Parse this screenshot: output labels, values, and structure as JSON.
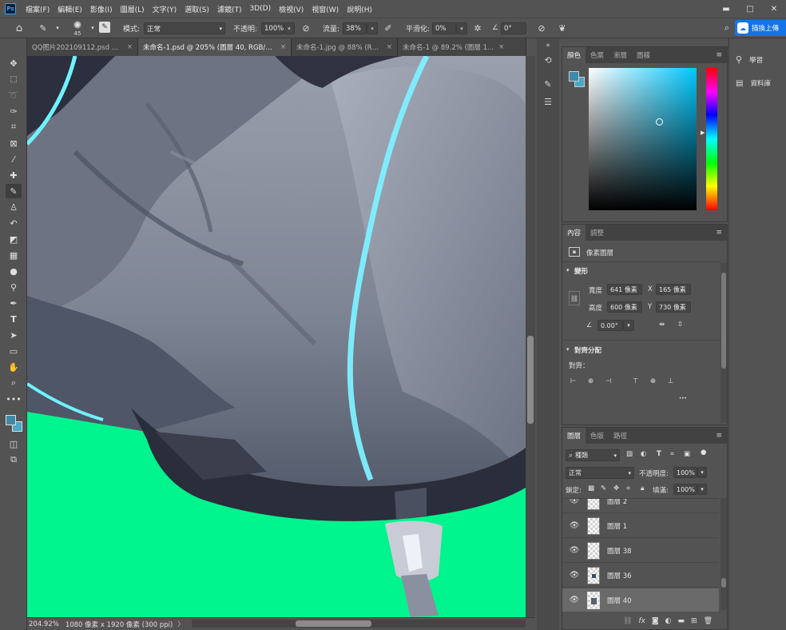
{
  "app": {
    "logo": "Ps"
  },
  "menu": [
    "檔案(F)",
    "編輯(E)",
    "影像(I)",
    "圖層(L)",
    "文字(Y)",
    "選取(S)",
    "濾鏡(T)",
    "3D(D)",
    "檢視(V)",
    "視窗(W)",
    "說明(H)"
  ],
  "window_controls": {
    "minimize": "▬",
    "maximize": "□",
    "close": "✕"
  },
  "options": {
    "brush_size": "45",
    "mode_label": "模式:",
    "mode_value": "正常",
    "opacity_label": "不透明:",
    "opacity_value": "100%",
    "flow_label": "流量:",
    "flow_value": "38%",
    "smoothing_label": "平滑化:",
    "smoothing_value": "0%",
    "angle_value": "0°",
    "share_button": "描換上傳"
  },
  "tabs": [
    {
      "label": "QQ图片202109112.psd @...",
      "active": false
    },
    {
      "label": "未命名-1.psd @ 205% (圖層 40, RGB/8) *",
      "active": true
    },
    {
      "label": "未命名-1.jpg @ 88% (RG...",
      "active": false
    },
    {
      "label": "未命名-1 @ 89.2% (圖層 1...",
      "active": false
    }
  ],
  "status": {
    "zoom": "204.92%",
    "doc_info": "1080 像素 x 1920 像素 (300 ppi)",
    "arrow": "〉"
  },
  "color_panel": {
    "tabs": [
      "顏色",
      "色票",
      "漸層",
      "圖樣"
    ],
    "foreground": "#3f8aa6",
    "background": "#4aa8c8",
    "hue": "#00c8ff"
  },
  "learn_panel": {
    "learn": "學習",
    "library": "資料庫"
  },
  "properties_panel": {
    "tabs": [
      "內容",
      "調整"
    ],
    "layer_type": "像素圖層",
    "transform_title": "變形",
    "width_label": "寬度",
    "width_value": "641 像素",
    "x_label": "X",
    "x_value": "165 像素",
    "height_label": "高度",
    "height_value": "600 像素",
    "y_label": "Y",
    "y_value": "730 像素",
    "angle_value": "0.00°",
    "align_title": "對齊分配",
    "align_label": "對齊：",
    "more": "···"
  },
  "layers_panel": {
    "tabs": [
      "圖層",
      "色版",
      "路徑"
    ],
    "filter_label": "種類",
    "blend_mode": "正常",
    "opacity_label": "不透明度:",
    "opacity_value": "100%",
    "lock_label": "鎖定:",
    "fill_label": "填滿:",
    "fill_value": "100%",
    "layers": [
      {
        "name": "圖層 2",
        "selected": false
      },
      {
        "name": "圖層 1",
        "selected": false
      },
      {
        "name": "圖層 38",
        "selected": false
      },
      {
        "name": "圖層 36",
        "selected": false
      },
      {
        "name": "圖層 40",
        "selected": true
      }
    ]
  }
}
